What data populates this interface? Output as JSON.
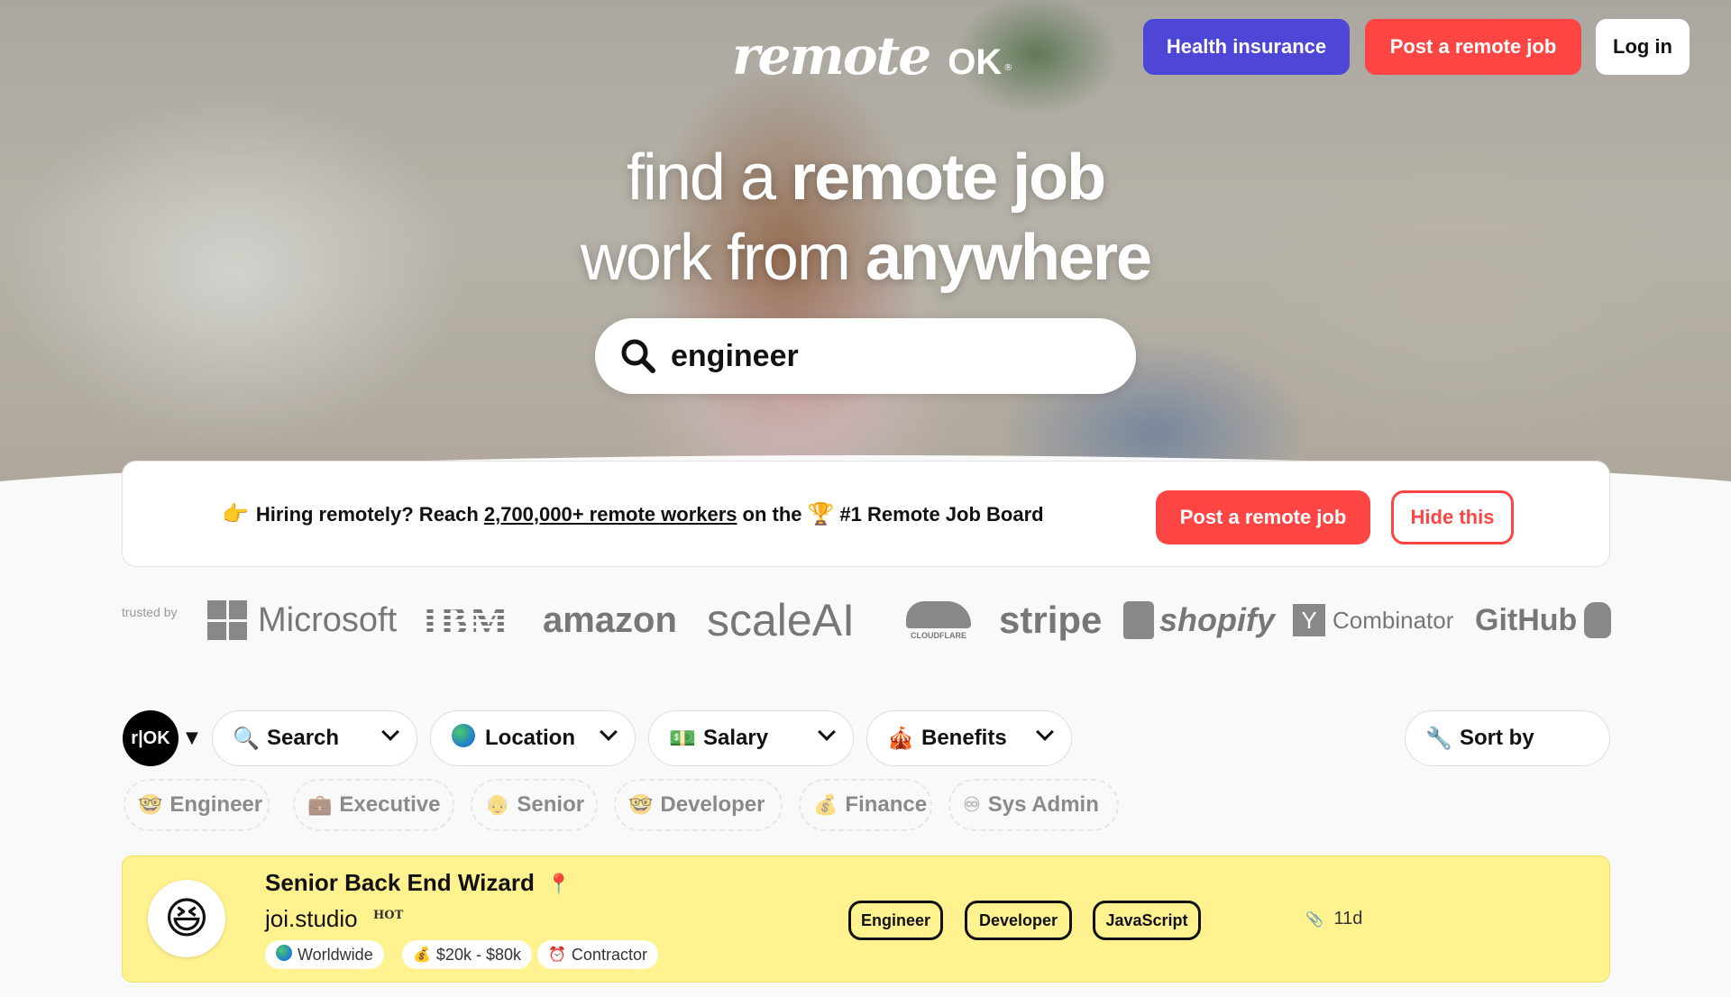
{
  "header": {
    "logo_text": "remote",
    "logo_ok": "OK",
    "logo_reg": "®",
    "buttons": {
      "health": "Health insurance",
      "post": "Post a remote job",
      "login": "Log in"
    }
  },
  "hero": {
    "line1_thin": "find a",
    "line1_bold": "remote job",
    "line2_thin": "work from",
    "line2_bold": "anywhere",
    "search_value": "engineer"
  },
  "banner": {
    "emoji_point": "👉",
    "text_before": "Hiring remotely? Reach",
    "link_text": "2,700,000+ remote workers",
    "text_after": "on the",
    "emoji_trophy": "🏆",
    "text_end": "#1 Remote Job Board",
    "post_label": "Post a remote job",
    "hide_label": "Hide this"
  },
  "trusted": {
    "label": "trusted by",
    "companies": [
      "Microsoft",
      "IBM",
      "amazon",
      "scaleAI",
      "CLOUDFLARE",
      "stripe",
      "shopify",
      "Combinator",
      "GitHub"
    ]
  },
  "filters": {
    "badge": "r|OK",
    "search_label": "Search",
    "location_label": "Location",
    "salary_label": "Salary",
    "benefits_label": "Benefits",
    "sort_label": "Sort by",
    "tags": [
      "Engineer",
      "Executive",
      "Senior",
      "Developer",
      "Finance",
      "Sys Admin"
    ]
  },
  "jobs": [
    {
      "title": "Senior Back End Wizard",
      "company": "joi.studio",
      "hot": "HOT",
      "location": "Worldwide",
      "salary": "$20k - $80k",
      "type": "Contractor",
      "tags": [
        "Engineer",
        "Developer",
        "JavaScript"
      ],
      "age": "11d"
    }
  ],
  "colors": {
    "accent_red": "#fd4543",
    "health_purple": "#4e46d6",
    "job_highlight": "#fff28f"
  }
}
